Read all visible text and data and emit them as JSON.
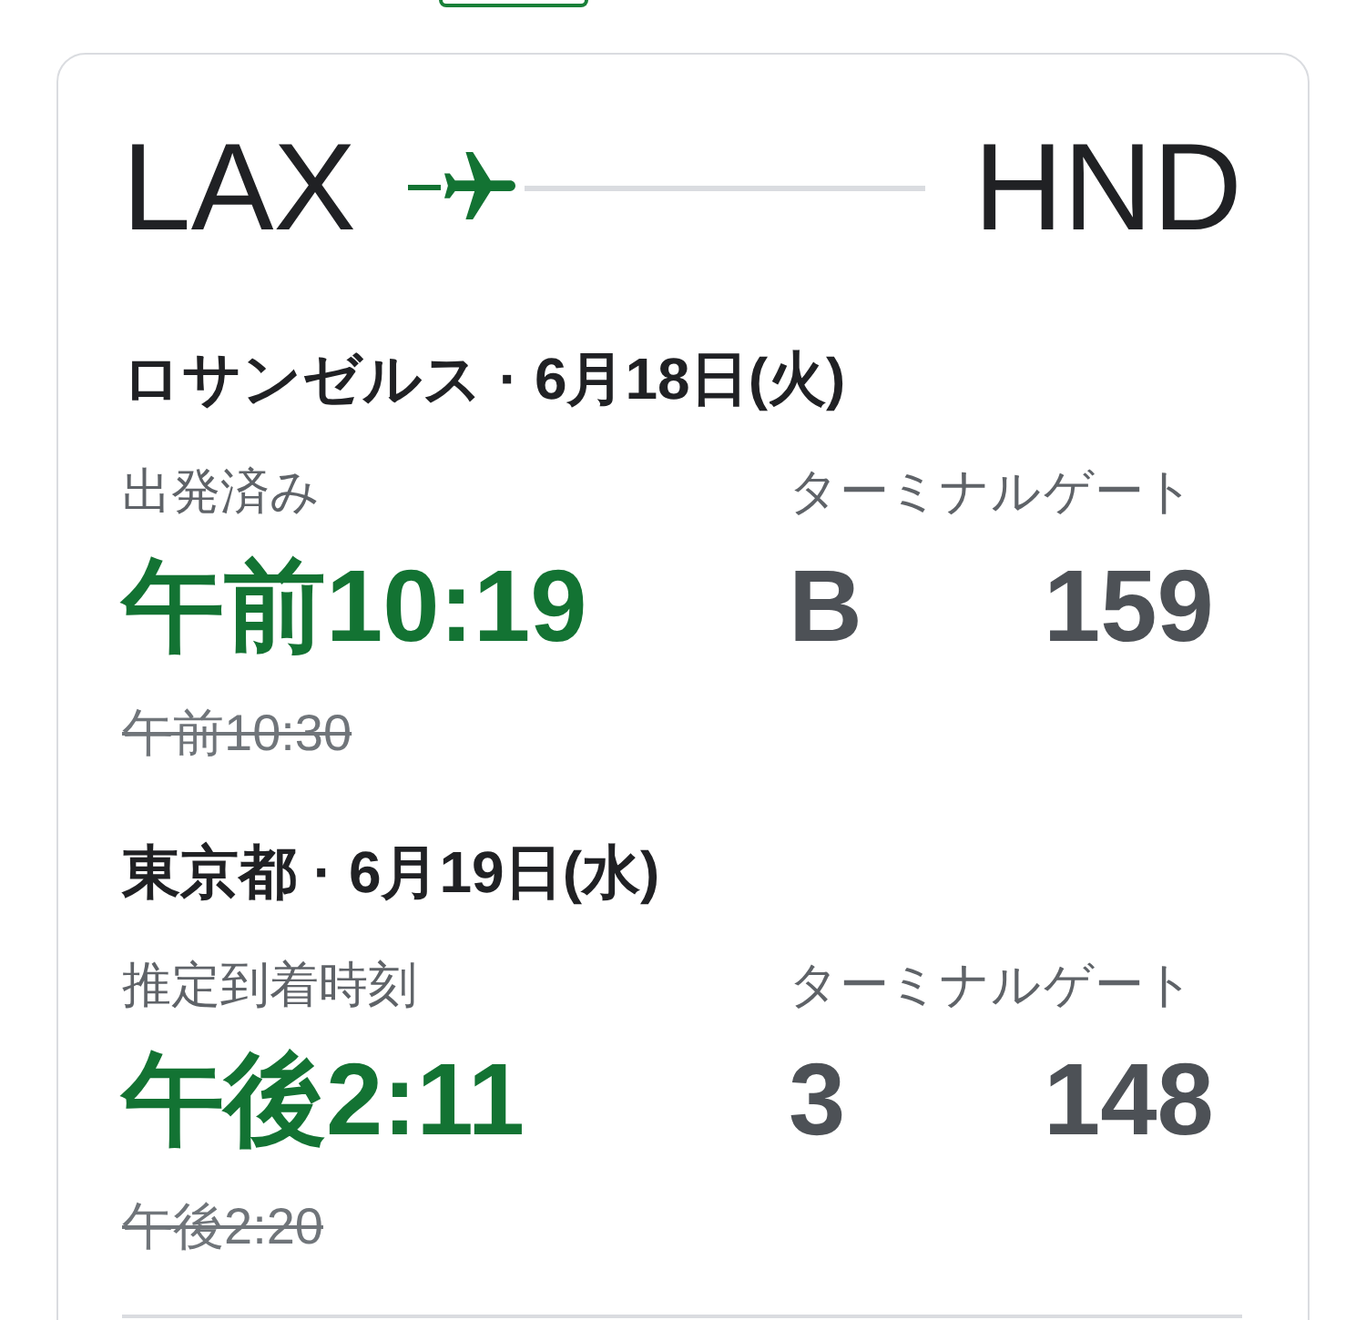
{
  "route": {
    "origin": "LAX",
    "destination": "HND"
  },
  "legs": [
    {
      "heading": "ロサンゼルス · 6月18日(火)",
      "status": "出発済み",
      "time": "午前10:19",
      "scheduled_time": "午前10:30",
      "terminal_label": "ターミナル",
      "terminal": "B",
      "gate_label": "ゲート",
      "gate": "159"
    },
    {
      "heading": "東京都 · 6月19日(水)",
      "status": "推定到着時刻",
      "time": "午後2:11",
      "scheduled_time": "午後2:20",
      "terminal_label": "ターミナル",
      "terminal": "3",
      "gate_label": "ゲート",
      "gate": "148"
    }
  ]
}
